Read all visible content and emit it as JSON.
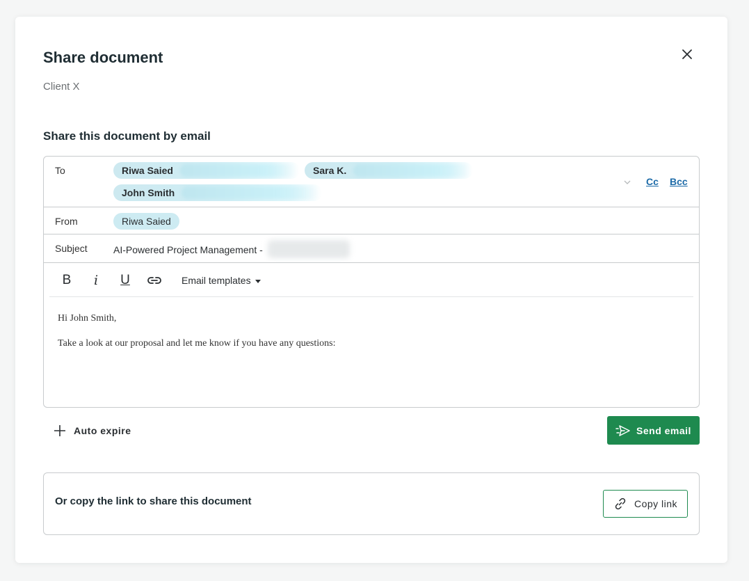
{
  "modal": {
    "title": "Share document",
    "subtitle": "Client X",
    "section_title": "Share this document by email"
  },
  "email": {
    "to_label": "To",
    "recipients": [
      "Riwa Saied",
      "Sara K.",
      "John Smith"
    ],
    "cc_label": "Cc",
    "bcc_label": "Bcc",
    "from_label": "From",
    "from_value": "Riwa Saied",
    "subject_label": "Subject",
    "subject_value": "AI-Powered Project Management -",
    "toolbar": {
      "bold": "B",
      "italic": "i",
      "underline": "U",
      "templates_label": "Email templates"
    },
    "body_lines": [
      "Hi John Smith,",
      "Take a look at our proposal and let me know if you have any questions:"
    ]
  },
  "actions": {
    "auto_expire_label": "Auto expire",
    "send_label": "Send email"
  },
  "copy": {
    "text": "Or copy the link to share this document",
    "button_label": "Copy link"
  },
  "colors": {
    "primary_green": "#1e8a4f",
    "chip_bg": "#cdebf2",
    "link_blue": "#1d6ba8"
  }
}
